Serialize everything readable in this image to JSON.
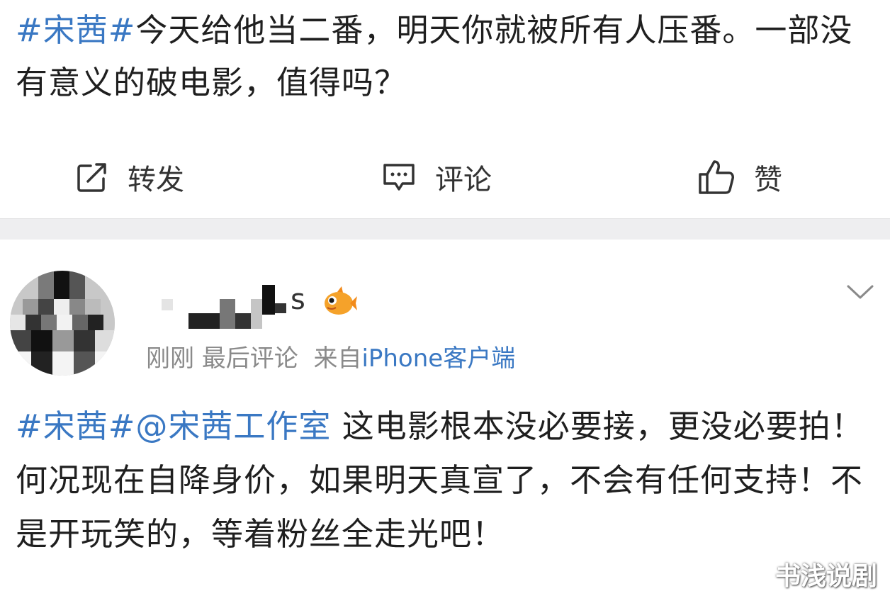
{
  "post": {
    "hashtag": "#宋茜#",
    "text": "今天给他当二番，明天你就被所有人压番。一部没有意义的破电影，值得吗？"
  },
  "actions": {
    "repost_label": "转发",
    "comment_label": "评论",
    "like_label": "赞"
  },
  "comment": {
    "username_suffix": "s",
    "meta_time": "刚刚",
    "meta_last": "最后评论",
    "meta_source_prefix": "来自",
    "meta_device": "iPhone客户端",
    "hashtag": "#宋茜#",
    "mention": "@宋茜工作室",
    "text": " 这电影根本没必要接，更没必要拍！何况现在自降身价，如果明天真宣了，不会有任何支持！不是开玩笑的，等着粉丝全走光吧！"
  },
  "watermark": "书浅说剧",
  "colors": {
    "link_blue": "#3a78c3",
    "separator_gray": "#eeeef0",
    "meta_gray": "#8a8a8a"
  },
  "icons": [
    "repost-icon",
    "comment-icon",
    "like-icon",
    "fish-badge-icon",
    "chevron-down-icon"
  ]
}
